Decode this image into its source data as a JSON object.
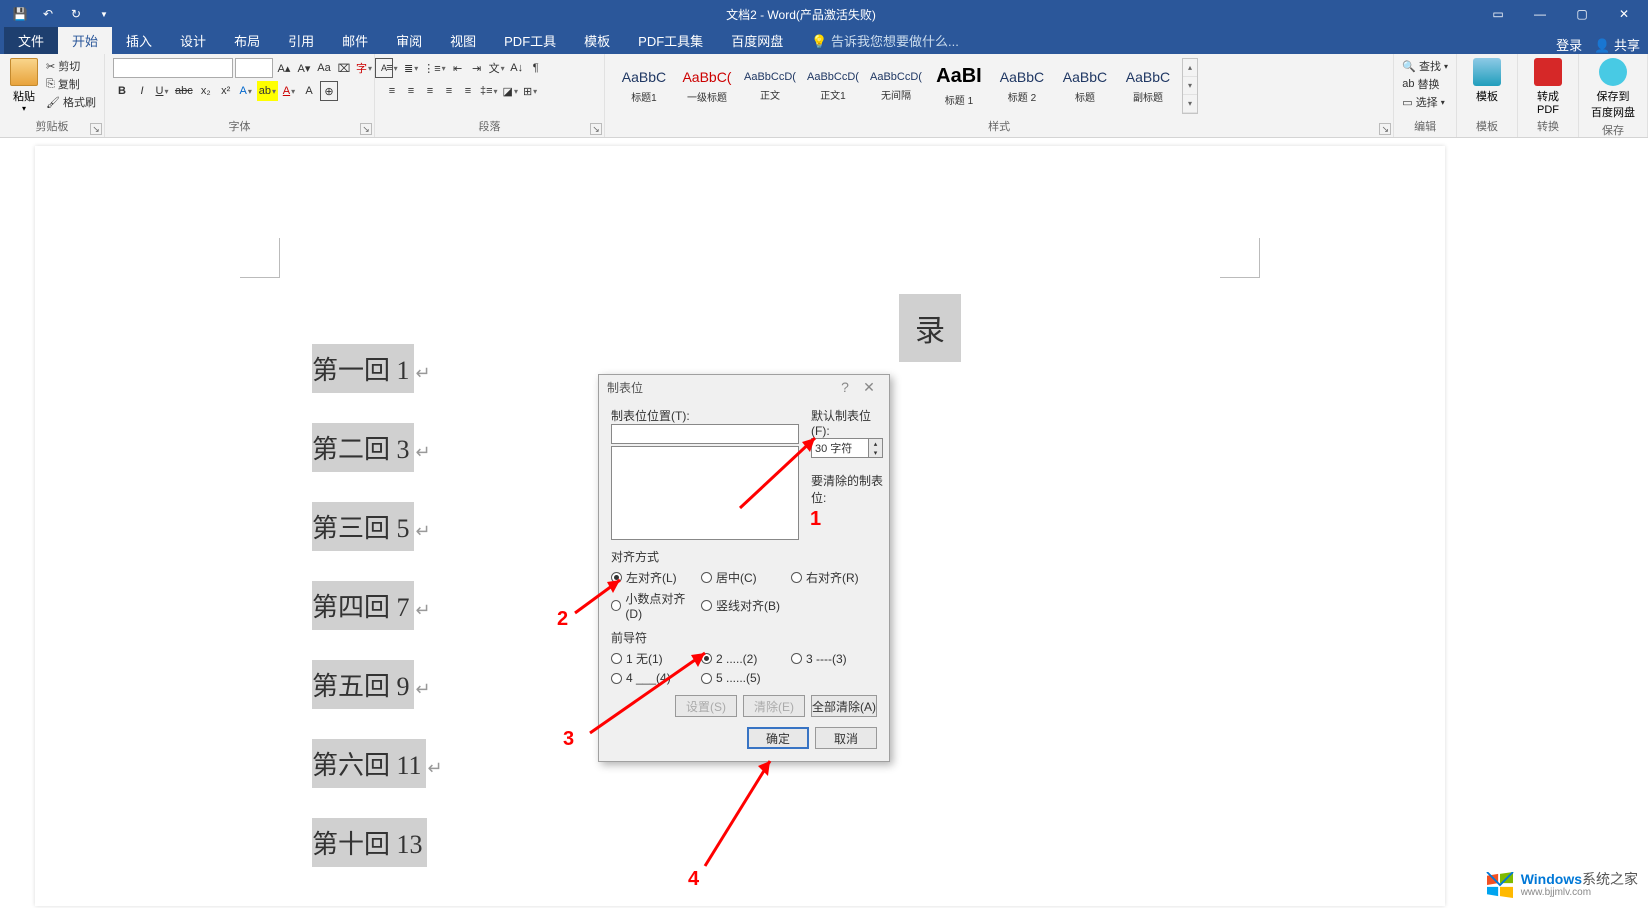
{
  "titlebar": {
    "title": "文档2 - Word(产品激活失败)"
  },
  "tabs": {
    "file": "文件",
    "home": "开始",
    "insert": "插入",
    "design": "设计",
    "layout": "布局",
    "references": "引用",
    "mailings": "邮件",
    "review": "审阅",
    "view": "视图",
    "pdf": "PDF工具",
    "templates": "模板",
    "pdfset": "PDF工具集",
    "baidu": "百度网盘",
    "tellme": "告诉我您想要做什么...",
    "login": "登录",
    "share": "共享"
  },
  "ribbon": {
    "clipboard": {
      "label": "剪贴板",
      "paste": "粘贴",
      "cut": "剪切",
      "copy": "复制",
      "format_painter": "格式刷"
    },
    "font": {
      "label": "字体"
    },
    "paragraph": {
      "label": "段落"
    },
    "styles": {
      "label": "样式",
      "items": [
        {
          "preview": "AaBbC",
          "name": "标题1",
          "cls": ""
        },
        {
          "preview": "AaBbC(",
          "name": "一级标题",
          "cls": "red"
        },
        {
          "preview": "AaBbCcD(",
          "name": "正文",
          "cls": ""
        },
        {
          "preview": "AaBbCcD(",
          "name": "正文1",
          "cls": ""
        },
        {
          "preview": "AaBbCcD(",
          "name": "无间隔",
          "cls": ""
        },
        {
          "preview": "AaBI",
          "name": "标题 1",
          "cls": "big"
        },
        {
          "preview": "AaBbC",
          "name": "标题 2",
          "cls": ""
        },
        {
          "preview": "AaBbC",
          "name": "标题",
          "cls": ""
        },
        {
          "preview": "AaBbC",
          "name": "副标题",
          "cls": ""
        }
      ]
    },
    "editing": {
      "label": "编辑",
      "find": "查找",
      "replace": "替换",
      "select": "选择"
    },
    "template": {
      "label": "模板",
      "btn": "模板"
    },
    "convert": {
      "label": "转换",
      "btn": "转成\nPDF"
    },
    "save": {
      "label": "保存",
      "btn": "保存到\n百度网盘"
    }
  },
  "document": {
    "lines": [
      {
        "text": "第一回 1",
        "num": "1"
      },
      {
        "text": "第二回 3",
        "num": "3"
      },
      {
        "text": "第三回 5",
        "num": "5"
      },
      {
        "text": "第四回 7",
        "num": "7"
      },
      {
        "text": "第五回 9",
        "num": "9"
      },
      {
        "text": "第六回 11",
        "num": "11"
      },
      {
        "text": "第十回 13",
        "num": "13"
      }
    ],
    "hidden": "录"
  },
  "dialog": {
    "title": "制表位",
    "pos_label": "制表位位置(T):",
    "default_label": "默认制表位(F):",
    "default_value": "30 字符",
    "clear_label": "要清除的制表位:",
    "align_label": "对齐方式",
    "align": {
      "left": "左对齐(L)",
      "center": "居中(C)",
      "right": "右对齐(R)",
      "decimal": "小数点对齐(D)",
      "bar": "竖线对齐(B)"
    },
    "leader_label": "前导符",
    "leader": {
      "none": "1 无(1)",
      "dots": "2 .....(2)",
      "dashes": "3 ----(3)",
      "under": "4 ___(4)",
      "dots2": "5 ......(5)"
    },
    "set": "设置(S)",
    "clear": "清除(E)",
    "clearall": "全部清除(A)",
    "ok": "确定",
    "cancel": "取消"
  },
  "annotations": {
    "n1": "1",
    "n2": "2",
    "n3": "3",
    "n4": "4"
  },
  "watermark": {
    "brand": "Windows",
    "suffix": "系统之家",
    "domain": "www.bjjmlv.com"
  }
}
